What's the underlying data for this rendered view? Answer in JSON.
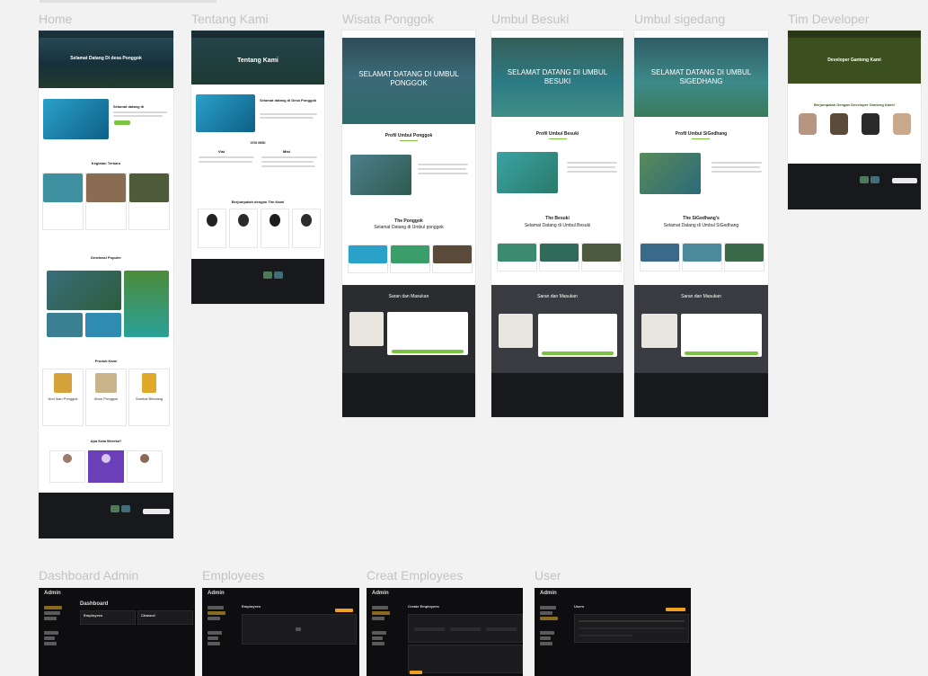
{
  "frames": {
    "home": {
      "label": "Home",
      "hero_title": "Selamat Datang Di desa Ponggok",
      "welcome_title": "Selamat datang di",
      "culinary_title": "Kegiatan Terbaru",
      "destination_title": "Destinasi Populer",
      "products_title": "Produk Kami",
      "products": [
        "Nori Ikan Ponggok",
        "Abon Ponggok",
        "Sambal Blindang"
      ],
      "testimony_title": "Apa Kata Mereka?"
    },
    "tentang": {
      "label": "Tentang Kami",
      "hero_title": "Tentang Kami",
      "welcome_title": "Selamat datang di Desa Ponggok",
      "visi_misi_title": "VISI MISI",
      "visi": "Visi",
      "misi": "Misi",
      "team_title": "Berjumpalah dengan Tim Kami"
    },
    "ponggok": {
      "label": "Wisata Ponggok",
      "hero_title": "SELAMAT DATANG DI UMBUL PONGGOK",
      "profile_title": "Profil Umbul Ponggok",
      "section_title": "The Ponggok",
      "section_sub": "Selamat Datang di Umbul ponggok",
      "feedback_title": "Saran dan Masukan"
    },
    "besuki": {
      "label": "Umbul Besuki",
      "hero_title": "SELAMAT DATANG DI UMBUL BESUKI",
      "profile_title": "Profil Umbul Besuki",
      "section_title": "The Besuki",
      "section_sub": "Selamat Datang di Umbul Besuki",
      "feedback_title": "Saran dan Masukan"
    },
    "sigedang": {
      "label": "Umbul sigedang",
      "hero_title": "SELAMAT DATANG DI UMBUL SIGEDHANG",
      "profile_title": "Profil Umbul SiGedhang",
      "section_title": "The SiGedhang's",
      "section_sub": "Selamat Datang di Umbul SiGedhang",
      "feedback_title": "Saran dan Masukan"
    },
    "developer": {
      "label": "Tim Developer",
      "hero_title": "Developer Ganteng Kami",
      "sub_title": "Berjumpalah Dengan Developer Ganteng Kami!"
    },
    "dashboard": {
      "label": "Dashboard Admin",
      "brand": "Admin",
      "title": "Dashboard",
      "card1": "Employees",
      "card2": "Channel"
    },
    "employees": {
      "label": "Employees",
      "brand": "Admin",
      "title": "Employees"
    },
    "create": {
      "label": "Creat Employees",
      "brand": "Admin",
      "title": "Create Employees"
    },
    "user": {
      "label": "User",
      "brand": "Admin",
      "title": "Users"
    }
  },
  "colors": {
    "accent": "#7cc242",
    "footer": "#17191c",
    "admin_bg": "#0e0e10",
    "accent_admin": "#f0a020"
  }
}
